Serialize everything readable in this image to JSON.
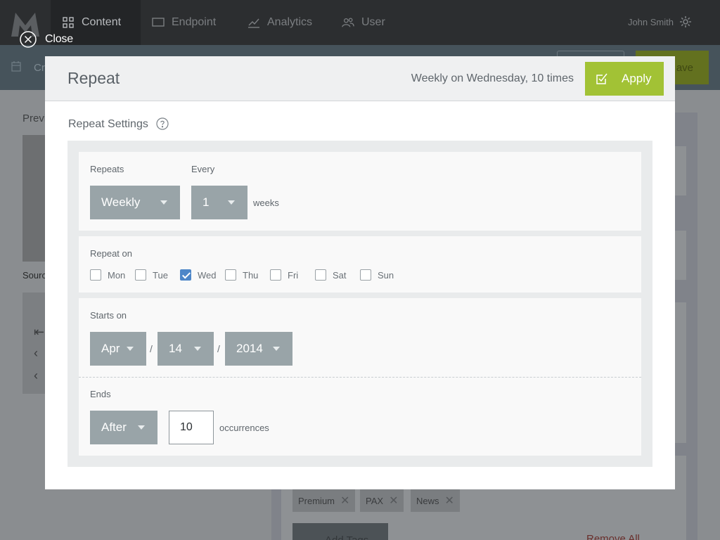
{
  "nav": {
    "items": [
      {
        "label": "Content",
        "icon": "grid-icon"
      },
      {
        "label": "Endpoint",
        "icon": "monitor-icon"
      },
      {
        "label": "Analytics",
        "icon": "chart-icon"
      },
      {
        "label": "User",
        "icon": "users-icon"
      }
    ],
    "user_name": "John Smith"
  },
  "background": {
    "subbar_text": "Cr",
    "save_label": "ave",
    "preview_label": "Previ",
    "source_label": "Sourc",
    "tags": [
      "Premium",
      "PAX",
      "News"
    ],
    "add_tags_label": "Add Tags",
    "remove_all_label": "Remove All"
  },
  "close": {
    "label": "Close"
  },
  "modal": {
    "title": "Repeat",
    "summary": "Weekly on Wednesday, 10 times",
    "apply_label": "Apply",
    "settings_title": "Repeat Settings"
  },
  "repeats": {
    "label": "Repeats",
    "value": "Weekly",
    "every_label": "Every",
    "every_value": "1",
    "every_suffix": "weeks"
  },
  "repeat_on": {
    "label": "Repeat on",
    "days": [
      {
        "label": "Mon",
        "checked": false
      },
      {
        "label": "Tue",
        "checked": false
      },
      {
        "label": "Wed",
        "checked": true
      },
      {
        "label": "Thu",
        "checked": false
      },
      {
        "label": "Fri",
        "checked": false
      },
      {
        "label": "Sat",
        "checked": false
      },
      {
        "label": "Sun",
        "checked": false
      }
    ]
  },
  "starts_on": {
    "label": "Starts on",
    "month": "Apr",
    "day": "14",
    "year": "2014",
    "separator": "/"
  },
  "ends": {
    "label": "Ends",
    "mode": "After",
    "occurrences": "10",
    "suffix": "occurrences"
  },
  "colors": {
    "accent_green": "#a2c235",
    "dropdown_gray": "#99a4a8",
    "checkbox_blue": "#4d86c8"
  }
}
